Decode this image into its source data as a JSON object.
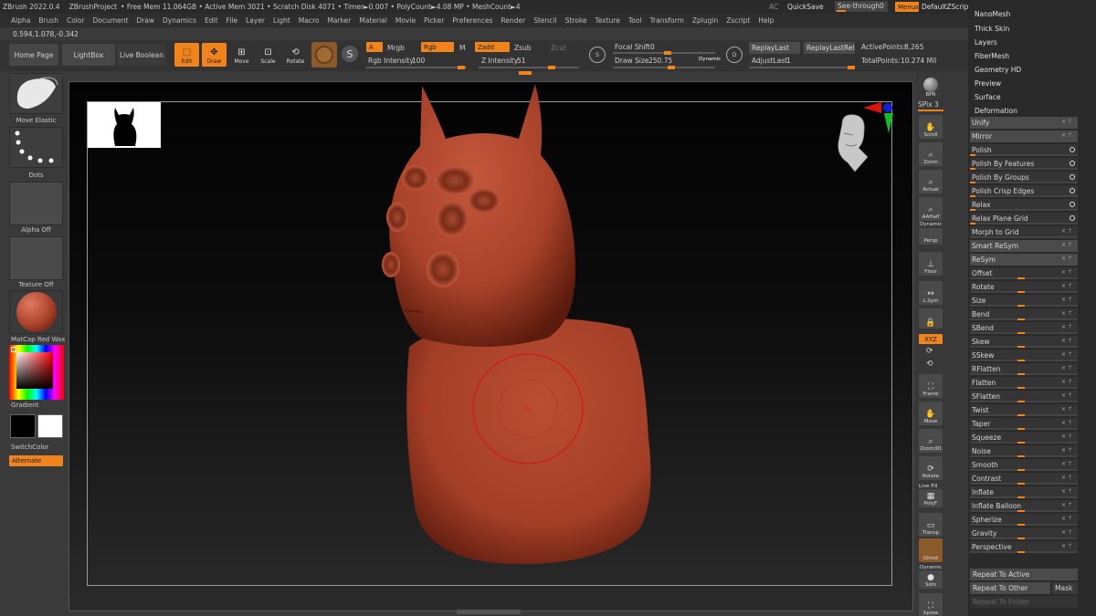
{
  "titlebar": {
    "app": "ZBrush 2022.0.4",
    "project": "ZBrushProject",
    "stats": "• Free Mem 11.064GB • Active Mem 3021 • Scratch Disk 4071 • Timer►0.007 • PolyCount►4.08 MP • MeshCount►4",
    "ac": "AC",
    "quicksave": "QuickSave",
    "seethrough": "See-through",
    "seethrough_value": "0",
    "menus": "Menus",
    "defaultzscript": "DefaultZScript"
  },
  "menubar": [
    "Alpha",
    "Brush",
    "Color",
    "Document",
    "Draw",
    "Dynamics",
    "Edit",
    "File",
    "Layer",
    "Light",
    "Macro",
    "Marker",
    "Material",
    "Movie",
    "Picker",
    "Preferences",
    "Render",
    "Stencil",
    "Stroke",
    "Texture",
    "Tool",
    "Transform",
    "Zplugin",
    "Zscript",
    "Help"
  ],
  "coords": "0.594,1.078,-0.342",
  "toolbar": {
    "home_page": "Home Page",
    "lightbox": "LightBox",
    "live_boolean": "Live Boolean",
    "edit": "Edit",
    "draw": "Draw",
    "move": "Move",
    "scale": "Scale",
    "rotate": "Rotate",
    "a": "A",
    "mrgb": "Mrgb",
    "rgb": "Rgb",
    "m": "M",
    "zadd": "Zadd",
    "zsub": "Zsub",
    "zcut": "Zcut",
    "rgb_intensity_label": "Rgb Intensity",
    "rgb_intensity": "100",
    "z_intensity_label": "Z Intensity",
    "z_intensity": "51",
    "focal_shift_label": "Focal Shift",
    "focal_shift": "0",
    "draw_size_label": "Draw Size",
    "draw_size": "250.75",
    "dynamic": "Dynamic",
    "replay_last": "ReplayLast",
    "replay_last_rel": "ReplayLastRel",
    "adjust_last_label": "AdjustLast",
    "adjust_last": "1",
    "active_points_label": "ActivePoints:",
    "active_points": "8,265",
    "total_points_label": "TotalPoints:",
    "total_points": "10.274 Mil",
    "s_label": "S",
    "d_label": "D"
  },
  "leftbar": {
    "brush": "Move Elastic",
    "stroke": "Dots",
    "alpha": "Alpha Off",
    "texture": "Texture Off",
    "material": "MatCap Red Wax",
    "gradient": "Gradient",
    "switchcolor": "SwitchColor",
    "alternate": "Alternate"
  },
  "rightbar": {
    "bpr": "BPR",
    "spix_label": "SPix",
    "spix": "3",
    "buttons": [
      "Scroll",
      "Zoom",
      "Actual",
      "AAHalf",
      "Persp",
      "Floor",
      "L.Sym",
      "",
      "XYZ",
      "",
      "",
      "Frame",
      "Move",
      "Zoom3D",
      "Rotate",
      "PolyF",
      "Transp",
      "Ghost",
      "Solo",
      "Xpose"
    ],
    "dynamic": "Dynamic",
    "line_fill": "Line Fill"
  },
  "panel": {
    "tabs": [
      "NanoMesh",
      "Thick Skin",
      "Layers",
      "FiberMesh",
      "Geometry HD",
      "Preview",
      "Surface",
      "Deformation"
    ],
    "items": [
      {
        "label": "Unify",
        "kind": "hdr"
      },
      {
        "label": "Mirror",
        "kind": "hdr"
      },
      {
        "label": "Polish",
        "kind": "dot"
      },
      {
        "label": "Polish By Features",
        "kind": "dot"
      },
      {
        "label": "Polish By Groups",
        "kind": "dot"
      },
      {
        "label": "Polish Crisp Edges",
        "kind": "dot"
      },
      {
        "label": "Relax",
        "kind": "dot"
      },
      {
        "label": "Relax Plane Grid",
        "kind": "dot"
      },
      {
        "label": "Morph to Grid",
        "kind": "sld"
      },
      {
        "label": "Smart ReSym",
        "kind": "hdr"
      },
      {
        "label": "ReSym",
        "kind": "hdr"
      },
      {
        "label": "Offset",
        "kind": "sld"
      },
      {
        "label": "Rotate",
        "kind": "sld"
      },
      {
        "label": "Size",
        "kind": "sld"
      },
      {
        "label": "Bend",
        "kind": "sld"
      },
      {
        "label": "SBend",
        "kind": "sld"
      },
      {
        "label": "Skew",
        "kind": "sld"
      },
      {
        "label": "SSkew",
        "kind": "sld"
      },
      {
        "label": "RFlatten",
        "kind": "sld"
      },
      {
        "label": "Flatten",
        "kind": "sld"
      },
      {
        "label": "SFlatten",
        "kind": "sld"
      },
      {
        "label": "Twist",
        "kind": "sld"
      },
      {
        "label": "Taper",
        "kind": "sld"
      },
      {
        "label": "Squeeze",
        "kind": "sld"
      },
      {
        "label": "Noise",
        "kind": "sld"
      },
      {
        "label": "Smooth",
        "kind": "sld"
      },
      {
        "label": "Contrast",
        "kind": "sld"
      },
      {
        "label": "Inflate",
        "kind": "sld"
      },
      {
        "label": "Inflate Balloon",
        "kind": "sld"
      },
      {
        "label": "Spherize",
        "kind": "sld"
      },
      {
        "label": "Gravity",
        "kind": "sld"
      },
      {
        "label": "Perspective",
        "kind": "sld"
      }
    ],
    "repeat_to_active": "Repeat To Active",
    "repeat_to_other": "Repeat To Other",
    "mask": "Mask",
    "repeat_to_folder": "Repeat To Folder"
  },
  "colors": {
    "accent": "#f0841a",
    "model": "#a9422a"
  }
}
